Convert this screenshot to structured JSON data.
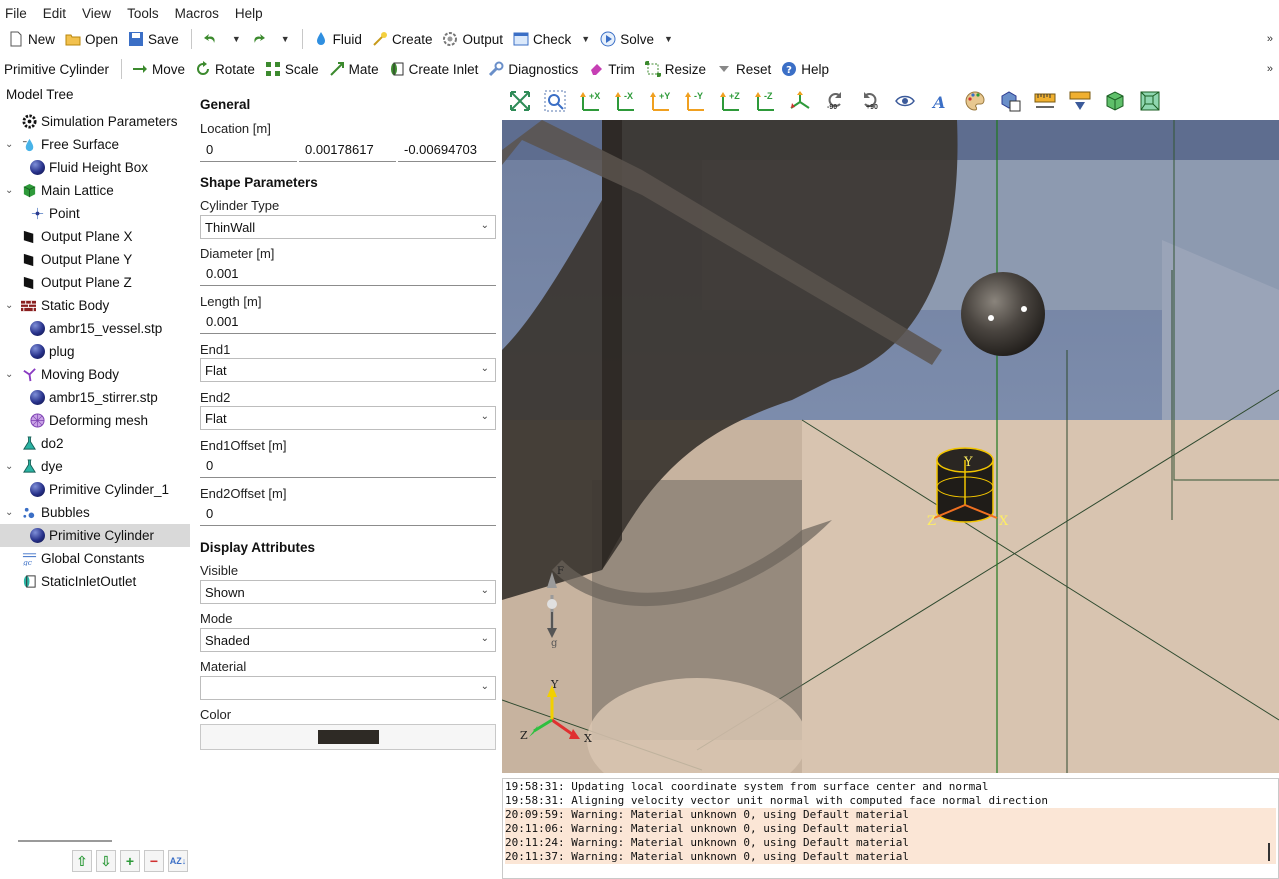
{
  "menu": [
    "File",
    "Edit",
    "View",
    "Tools",
    "Macros",
    "Help"
  ],
  "toolbar1": {
    "new": "New",
    "open": "Open",
    "save": "Save",
    "fluid": "Fluid",
    "create": "Create",
    "output": "Output",
    "check": "Check",
    "solve": "Solve"
  },
  "toolbar2": {
    "context": "Primitive Cylinder",
    "move": "Move",
    "rotate": "Rotate",
    "scale": "Scale",
    "mate": "Mate",
    "create_inlet": "Create Inlet",
    "diagnostics": "Diagnostics",
    "trim": "Trim",
    "resize": "Resize",
    "reset": "Reset",
    "help": "Help"
  },
  "tree": {
    "title": "Model Tree",
    "items": [
      {
        "label": "Simulation Parameters",
        "icon": "gear-icon"
      },
      {
        "label": "Free Surface",
        "icon": "water-drop-icon"
      },
      {
        "label": "Fluid Height Box",
        "icon": "sphere-icon"
      },
      {
        "label": "Main Lattice",
        "icon": "green-cube-icon"
      },
      {
        "label": "Point",
        "icon": "point-icon"
      },
      {
        "label": "Output Plane X",
        "icon": "plane-icon"
      },
      {
        "label": "Output Plane Y",
        "icon": "plane-icon"
      },
      {
        "label": "Output Plane Z",
        "icon": "plane-icon"
      },
      {
        "label": "Static Body",
        "icon": "brick-wall-icon"
      },
      {
        "label": "ambr15_vessel.stp",
        "icon": "sphere-icon"
      },
      {
        "label": "plug",
        "icon": "sphere-icon"
      },
      {
        "label": "Moving Body",
        "icon": "rotor-icon"
      },
      {
        "label": "ambr15_stirrer.stp",
        "icon": "sphere-icon"
      },
      {
        "label": "Deforming mesh",
        "icon": "mesh-sphere-icon"
      },
      {
        "label": "do2",
        "icon": "flask-icon"
      },
      {
        "label": "dye",
        "icon": "flask-icon"
      },
      {
        "label": "Primitive Cylinder_1",
        "icon": "sphere-icon"
      },
      {
        "label": "Bubbles",
        "icon": "bubbles-icon"
      },
      {
        "label": "Primitive Cylinder",
        "icon": "sphere-icon"
      },
      {
        "label": "Global Constants",
        "icon": "gc-icon"
      },
      {
        "label": "StaticInletOutlet",
        "icon": "inlet-icon"
      }
    ],
    "selected": "Primitive Cylinder"
  },
  "props": {
    "general_title": "General",
    "location_label": "Location [m]",
    "location": [
      "0",
      "0.00178617",
      "-0.00694703"
    ],
    "shape_title": "Shape Parameters",
    "cylinder_type_label": "Cylinder Type",
    "cylinder_type": "ThinWall",
    "diameter_label": "Diameter [m]",
    "diameter": "0.001",
    "length_label": "Length [m]",
    "length": "0.001",
    "end1_label": "End1",
    "end1": "Flat",
    "end2_label": "End2",
    "end2": "Flat",
    "end1offset_label": "End1Offset [m]",
    "end1offset": "0",
    "end2offset_label": "End2Offset [m]",
    "end2offset": "0",
    "display_title": "Display Attributes",
    "visible_label": "Visible",
    "visible": "Shown",
    "mode_label": "Mode",
    "mode": "Shaded",
    "material_label": "Material",
    "material": "",
    "color_label": "Color",
    "color_value": "#2e2a25"
  },
  "viewport_tools": {
    "plus_x": "+X",
    "minus_x": "-X",
    "plus_y": "+Y",
    "minus_y": "-Y",
    "plus_z": "+Z",
    "minus_z": "-Z",
    "rot_minus": "-90",
    "rot_plus": "+90"
  },
  "viewport": {
    "gizmo_y": "Y",
    "gizmo_x": "X",
    "gizmo_z": "Z",
    "axes_y": "Y",
    "axes_x": "X",
    "axes_z": "Z",
    "gravity_top": "F",
    "gravity_bottom": "g"
  },
  "log": [
    {
      "text": "19:58:31: Updating local coordinate system from surface center and normal",
      "type": "info"
    },
    {
      "text": "19:58:31: Aligning velocity vector unit normal with computed face normal direction",
      "type": "info"
    },
    {
      "text": "20:09:59: Warning: Material unknown 0, using Default material",
      "type": "warn"
    },
    {
      "text": "20:11:06: Warning: Material unknown 0, using Default material",
      "type": "warn"
    },
    {
      "text": "20:11:24: Warning: Material unknown 0, using Default material",
      "type": "warn"
    },
    {
      "text": "20:11:37: Warning: Material unknown 0, using Default material",
      "type": "warn"
    }
  ]
}
